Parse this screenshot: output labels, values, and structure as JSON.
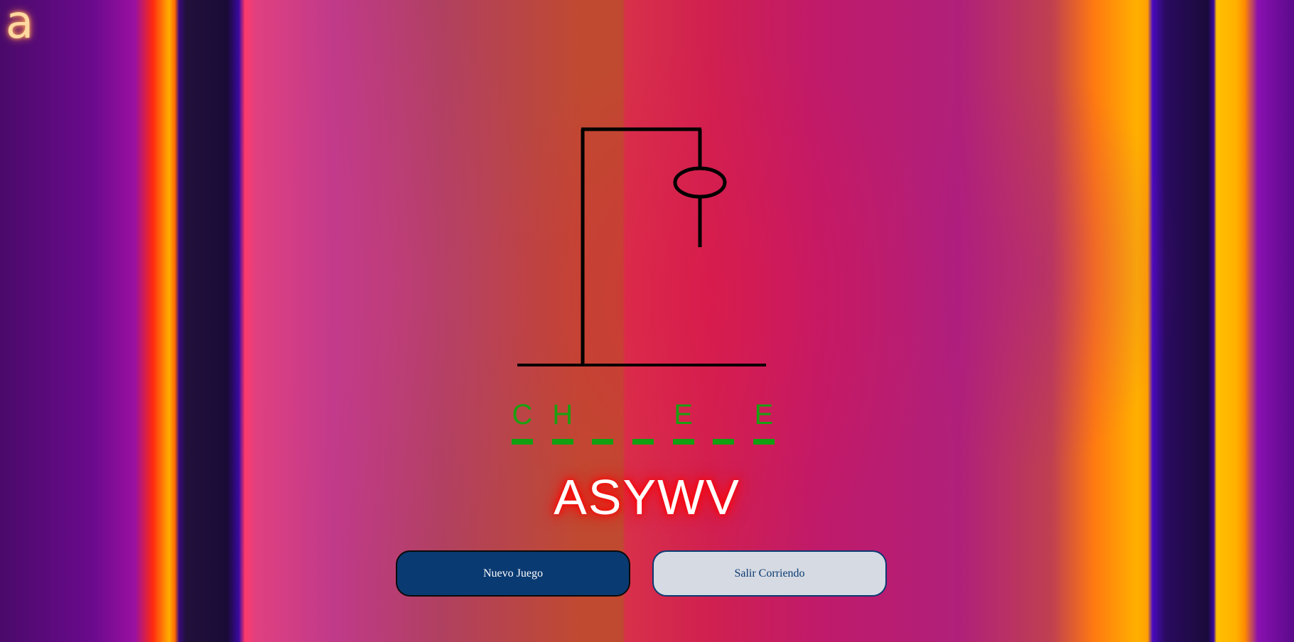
{
  "logo": {
    "text": "a"
  },
  "hangman": {
    "errors_shown": 1,
    "word_slots": [
      "C",
      "H",
      "",
      "",
      "E",
      "",
      "E"
    ]
  },
  "wrong_letters": "ASYWV",
  "buttons": {
    "new_game_label": "Nuevo Juego",
    "exit_label": "Salir Corriendo"
  },
  "colors": {
    "correct_letter": "#1aa010",
    "wrong_letter_glow": "#ff0000",
    "primary_button": "#0a3a72",
    "secondary_button": "#d6dae2"
  }
}
